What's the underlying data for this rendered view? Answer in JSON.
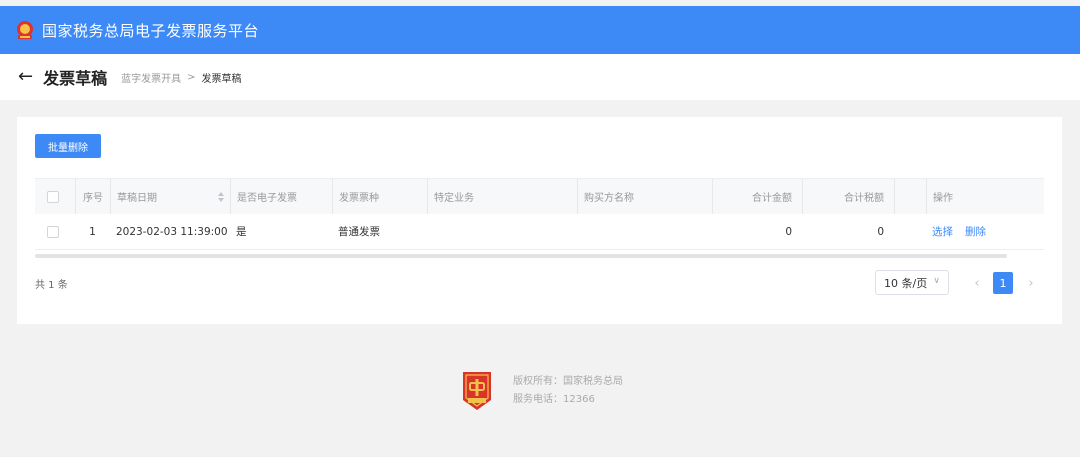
{
  "app": {
    "title": "国家税务总局电子发票服务平台"
  },
  "header": {
    "title": "发票草稿",
    "breadcrumb": [
      "蓝字发票开具",
      "发票草稿"
    ],
    "separator": ">"
  },
  "toolbar": {
    "batch_delete_label": "批量删除"
  },
  "table": {
    "columns": [
      "序号",
      "草稿日期",
      "是否电子发票",
      "发票票种",
      "特定业务",
      "购买方名称",
      "合计金额",
      "合计税额",
      "操作"
    ],
    "rows": [
      {
        "index": "1",
        "date": "2023-02-03 11:39:00",
        "is_electronic": "是",
        "invoice_type": "普通发票",
        "business": "",
        "buyer": "",
        "amount": "0",
        "tax": "0",
        "actions": [
          "选择",
          "删除"
        ]
      }
    ]
  },
  "pagination": {
    "total_text": "共 1 条",
    "page_size": "10 条/页",
    "current_page": "1"
  },
  "footer": {
    "copyright": "版权所有：国家税务总局",
    "phone": "服务电话：12366"
  },
  "colors": {
    "primary": "#3d8af7",
    "page_bg": "#f2f2f2",
    "header_bg": "#f7f8fa"
  },
  "icons": {
    "emblem": "national-emblem-icon",
    "back": "back-arrow-icon",
    "sort": "sort-icon",
    "page_size_dropdown": "chevron-down-icon",
    "prev": "chevron-left-icon",
    "next": "chevron-right-icon",
    "footer_badge": "tax-badge-icon"
  }
}
